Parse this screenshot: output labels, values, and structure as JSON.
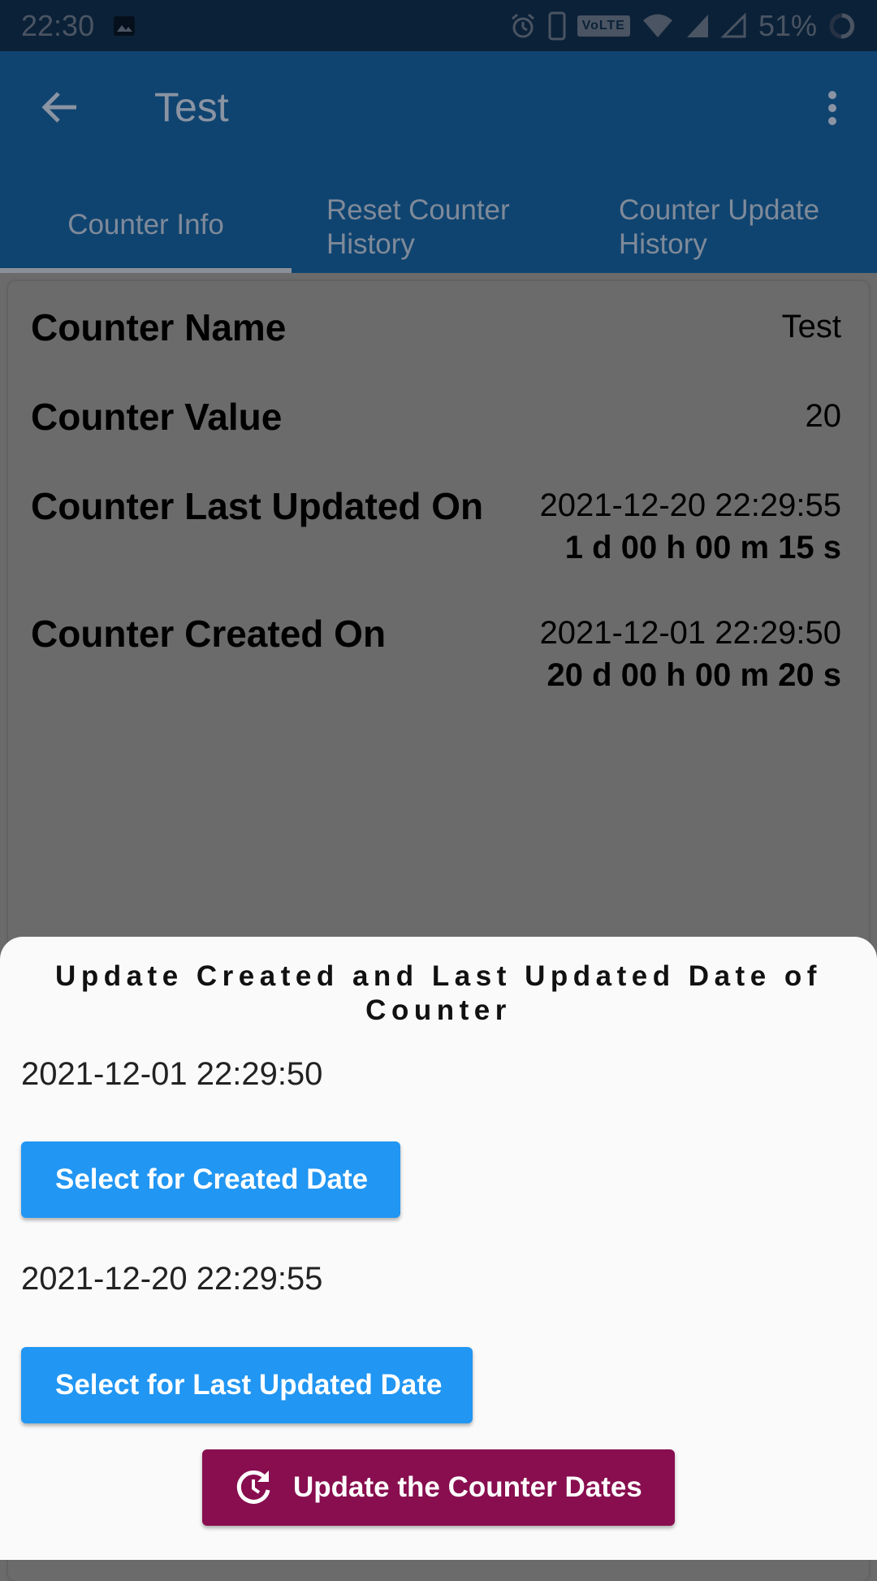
{
  "status_bar": {
    "time": "22:30",
    "volte": "VoLTE",
    "battery": "51%",
    "icons": [
      "image-icon",
      "alarm-icon",
      "phone-icon",
      "volte-icon",
      "wifi-icon",
      "signal-icon",
      "signal-empty-icon",
      "battery-icon"
    ]
  },
  "app_bar": {
    "title": "Test",
    "tabs": [
      {
        "label": "Counter Info"
      },
      {
        "label": "Reset Counter History"
      },
      {
        "label": "Counter Update History"
      }
    ]
  },
  "counter": {
    "name_label": "Counter Name",
    "name_value": "Test",
    "value_label": "Counter Value",
    "value": "20",
    "last_updated_label": "Counter Last Updated On",
    "last_updated_date": "2021-12-20 22:29:55",
    "last_updated_ago": "1 d 00 h 00 m 15 s",
    "created_label": "Counter Created On",
    "created_date": "2021-12-01 22:29:50",
    "created_ago": "20 d 00 h 00 m 20 s"
  },
  "sheet": {
    "title": "Update Created and Last Updated Date of Counter",
    "created_date": "2021-12-01 22:29:50",
    "select_created_label": "Select for Created Date",
    "last_updated_date": "2021-12-20 22:29:55",
    "select_last_updated_label": "Select for Last Updated Date",
    "update_button_label": "Update the Counter Dates"
  },
  "colors": {
    "app_bar": "#104470",
    "status_bar": "#0b2138",
    "scrim": "#6b6b6b",
    "primary_button": "#2196f3",
    "update_button": "#880e4f"
  }
}
